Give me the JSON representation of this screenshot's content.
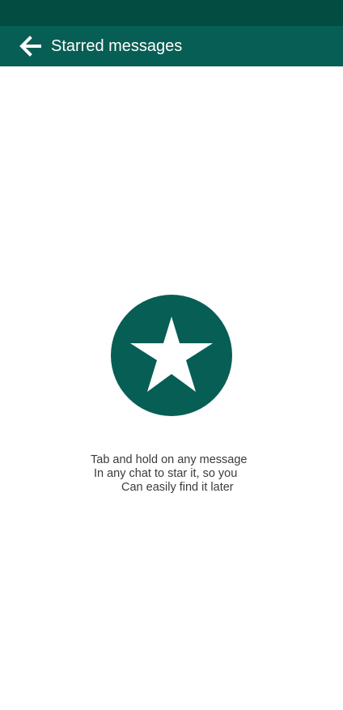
{
  "header": {
    "title": "Starred messages",
    "back_icon": "arrow-left-icon"
  },
  "empty_state": {
    "icon": "star-icon",
    "lines": [
      "Tab and hold on any message",
      "In any chat to star it, so you",
      "Can easily find it later"
    ]
  },
  "colors": {
    "status_bar": "#034c41",
    "app_bar": "#075e54",
    "accent": "#075e54",
    "text": "#3b3b3b",
    "background": "#ffffff"
  }
}
